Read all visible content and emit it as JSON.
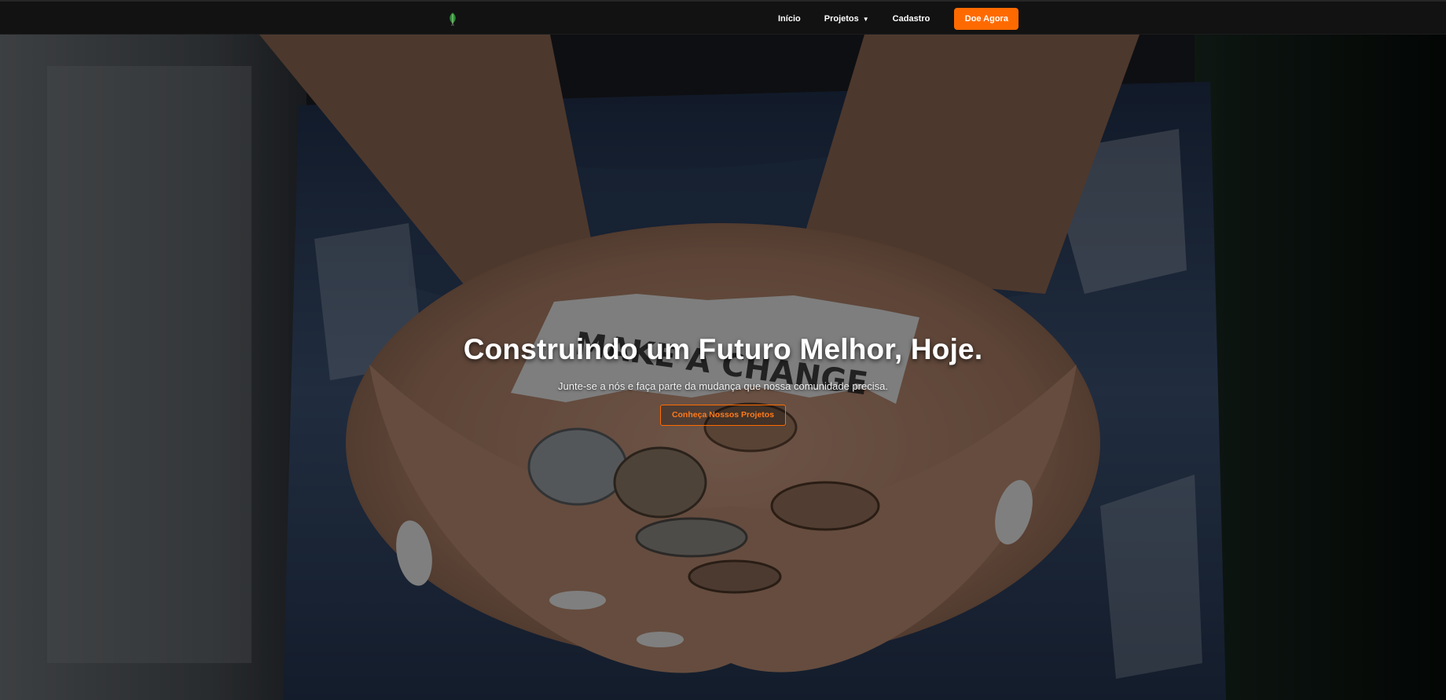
{
  "nav": {
    "logo_icon": "leaf-logo-icon",
    "links": [
      {
        "label": "Início"
      },
      {
        "label": "Projetos"
      },
      {
        "label": "Cadastro"
      }
    ],
    "projects_caret": "▼",
    "donate_label": "Doe Agora"
  },
  "hero": {
    "title": "Construindo um Futuro Melhor, Hoje.",
    "subtitle": "Junte-se a nós e faça parte da mudança que nossa comunidade precisa.",
    "cta_label": "Conheça Nossos Projetos",
    "background_image": "hands-holding-coins-make-a-change-photo",
    "note_text": "MAKE A CHANGE"
  },
  "colors": {
    "accent": "#ff6a00",
    "navbar": "#121212",
    "text": "#ffffff"
  }
}
